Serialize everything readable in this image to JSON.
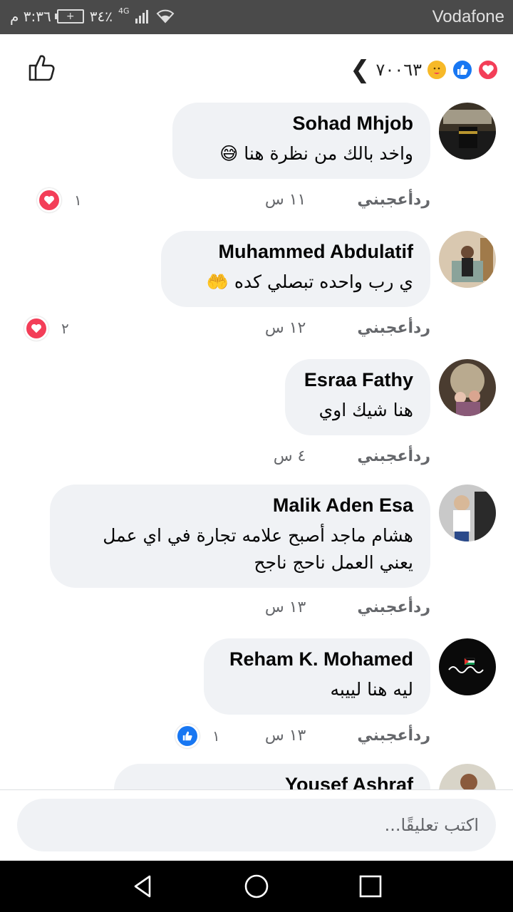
{
  "status_bar": {
    "time": "٣:٣٦ م",
    "battery": "٣٤٪",
    "network": "4G",
    "carrier": "Vodafone"
  },
  "header": {
    "reaction_count": "٧٠٠٦٣",
    "reaction_icons": [
      "heart",
      "like",
      "care"
    ],
    "like_icon": "thumbs-up-outline-icon",
    "back_icon": "chevron-left-icon"
  },
  "comments": [
    {
      "author": "Sohad Mhjob",
      "text": "واخد بالك من نظرة هنا 😅",
      "time": "١١ س",
      "like_label": "أعجبني",
      "reply_label": "رد",
      "reaction": {
        "type": "heart",
        "count": "١"
      }
    },
    {
      "author": "Muhammed Abdulatif",
      "text": "ي رب واحده تبصلي كده 🤲",
      "time": "١٢ س",
      "like_label": "أعجبني",
      "reply_label": "رد",
      "reaction": {
        "type": "heart",
        "count": "٢"
      }
    },
    {
      "author": "Esraa Fathy",
      "text": "هنا شيك اوي",
      "time": "٤ س",
      "like_label": "أعجبني",
      "reply_label": "رد"
    },
    {
      "author": "Malik Aden Esa",
      "text": "هشام ماجد أصبح علامه تجارة في اي عمل يعني العمل ناحج ناجح",
      "time": "١٣ س",
      "like_label": "أعجبني",
      "reply_label": "رد"
    },
    {
      "author": "Reham K. Mohamed",
      "text": "ليه هنا لييبه",
      "time": "١٣ س",
      "like_label": "أعجبني",
      "reply_label": "رد",
      "reaction": {
        "type": "like",
        "count": "١"
      }
    },
    {
      "author": "Yousef Ashraf"
    }
  ],
  "comment_input": {
    "placeholder": "اكتب تعليقًا..."
  },
  "colors": {
    "status_bar": "#4a4a4a",
    "bubble": "#f0f2f5",
    "heart": "#f33e58",
    "like": "#1877f2",
    "care": "#f7b928"
  }
}
